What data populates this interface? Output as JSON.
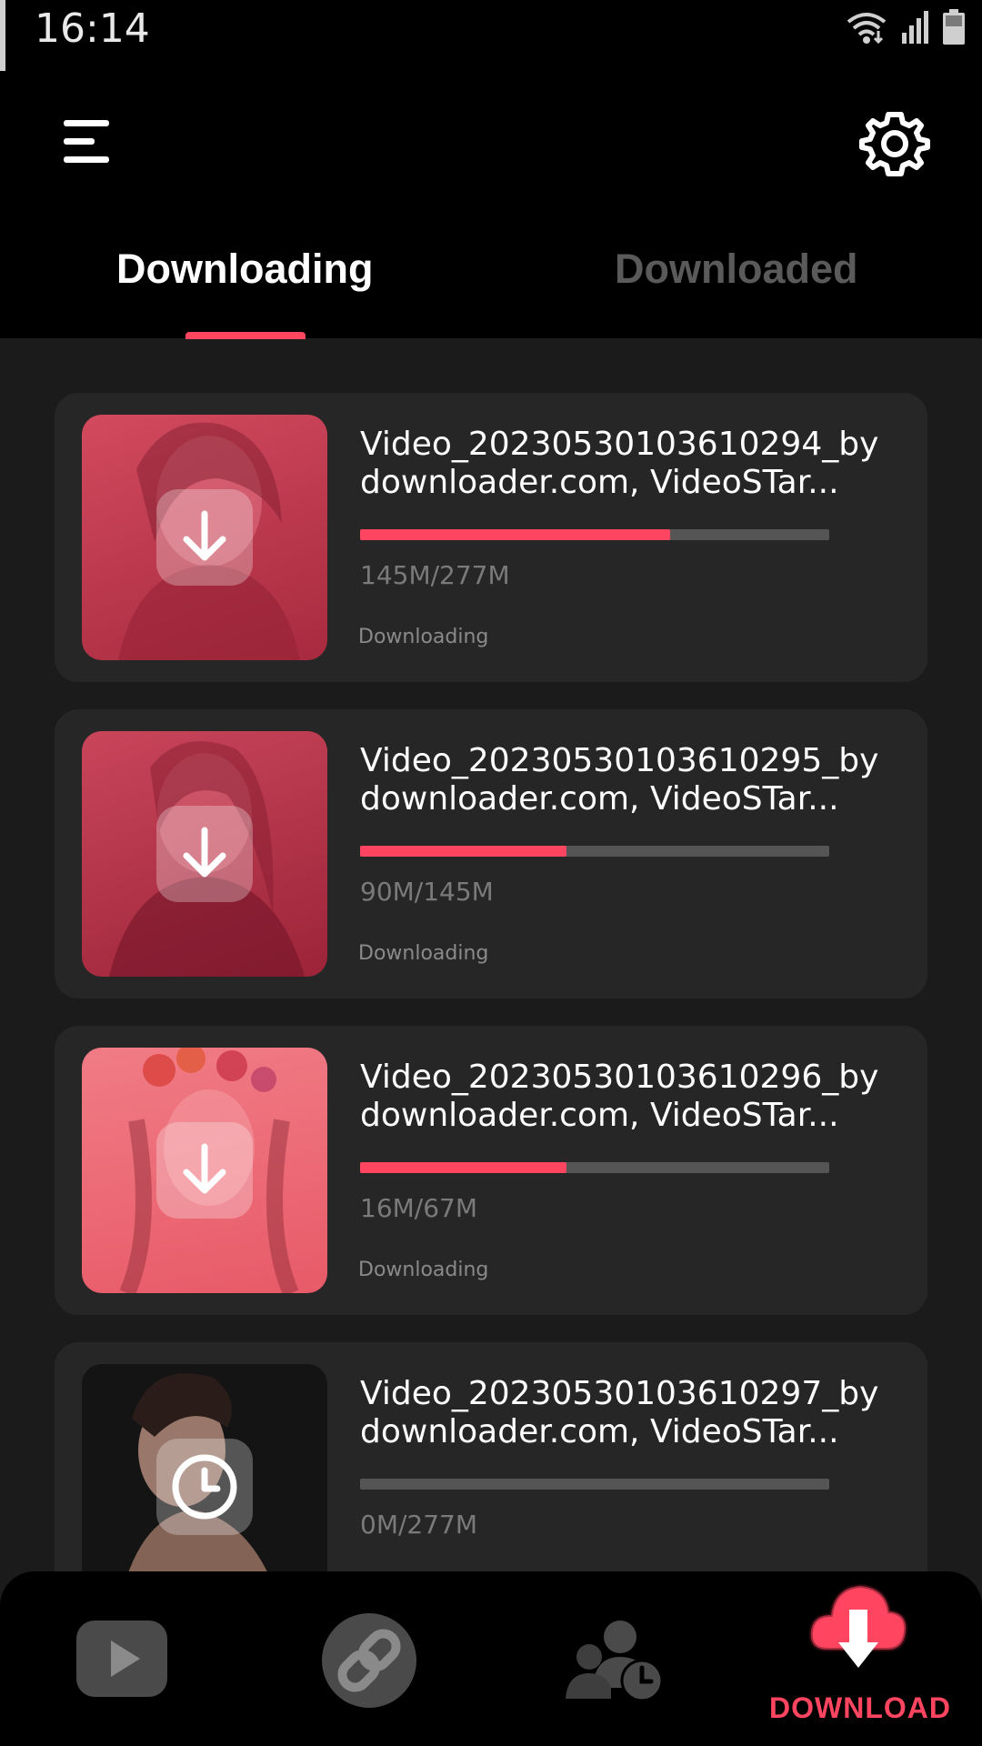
{
  "status_bar": {
    "time": "16:14"
  },
  "tabs": [
    {
      "label": "Downloading",
      "active": true
    },
    {
      "label": "Downloaded",
      "active": false
    }
  ],
  "downloads": [
    {
      "title": "Video_20230530103610294_by downloader.com, VideoSTar...",
      "progress_percent": 66,
      "size": "145M/277M",
      "state": "Downloading",
      "overlay_icon": "download-arrow-icon",
      "thumb_color": "#c8374d"
    },
    {
      "title": "Video_20230530103610295_by downloader.com, VideoSTar...",
      "progress_percent": 44,
      "size": "90M/145M",
      "state": "Downloading",
      "overlay_icon": "download-arrow-icon",
      "thumb_color": "#b93246"
    },
    {
      "title": "Video_20230530103610296_by downloader.com, VideoSTar...",
      "progress_percent": 44,
      "size": "16M/67M",
      "state": "Downloading",
      "overlay_icon": "download-arrow-icon",
      "thumb_color": "#ef6f7a"
    },
    {
      "title": "Video_20230530103610297_by downloader.com, VideoSTar...",
      "progress_percent": 0,
      "size": "0M/277M",
      "state": "",
      "overlay_icon": "clock-icon",
      "thumb_color": "#1c1c1c"
    }
  ],
  "bottom_nav": {
    "items": [
      {
        "icon": "play-icon"
      },
      {
        "icon": "link-icon"
      },
      {
        "icon": "users-clock-icon"
      },
      {
        "icon": "cloud-download-icon",
        "label": "DOWNLOAD",
        "active": true
      }
    ]
  },
  "colors": {
    "accent": "#ff4560",
    "background": "#1b1b1b",
    "card": "#262626"
  }
}
